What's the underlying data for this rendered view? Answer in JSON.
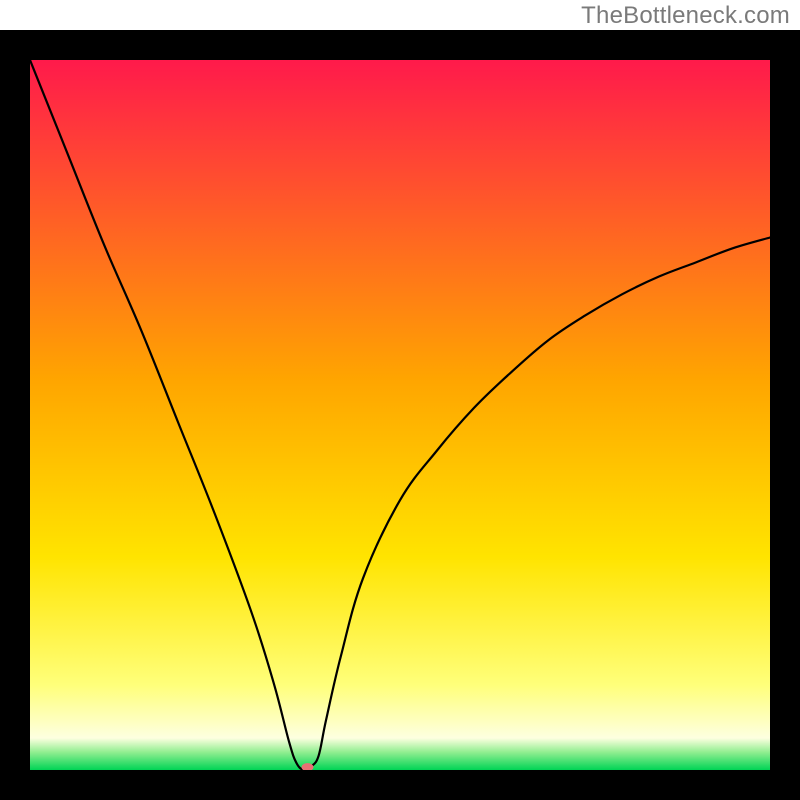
{
  "watermark": "TheBottleneck.com",
  "chart_data": {
    "type": "line",
    "title": "",
    "xlabel": "",
    "ylabel": "",
    "xlim": [
      0,
      100
    ],
    "ylim": [
      0,
      100
    ],
    "grid": false,
    "background_gradient": {
      "stops": [
        {
          "offset": 0.0,
          "color": "#ff1a4b"
        },
        {
          "offset": 0.45,
          "color": "#ffa500"
        },
        {
          "offset": 0.7,
          "color": "#ffe400"
        },
        {
          "offset": 0.88,
          "color": "#ffff7a"
        },
        {
          "offset": 0.955,
          "color": "#fdffe0"
        },
        {
          "offset": 0.975,
          "color": "#90ee90"
        },
        {
          "offset": 1.0,
          "color": "#00d455"
        }
      ]
    },
    "series": [
      {
        "name": "bottleneck-curve",
        "color": "#000000",
        "x": [
          0,
          5,
          10,
          15,
          20,
          25,
          30,
          33,
          35,
          36,
          37,
          38,
          39,
          40,
          42,
          45,
          50,
          55,
          60,
          65,
          70,
          75,
          80,
          85,
          90,
          95,
          100
        ],
        "values": [
          100,
          87,
          74,
          62,
          49,
          36,
          22,
          12,
          4,
          1,
          0,
          0.5,
          2,
          7,
          16,
          27,
          38,
          45,
          51,
          56,
          60.5,
          64,
          67,
          69.5,
          71.5,
          73.5,
          75
        ]
      }
    ],
    "annotations": [
      {
        "name": "vertex-marker",
        "x": 37.5,
        "y": 0.4,
        "color": "#e96f74",
        "rx": 6,
        "ry": 4
      }
    ],
    "frame": {
      "stroke": "#000000",
      "width": 30
    }
  }
}
